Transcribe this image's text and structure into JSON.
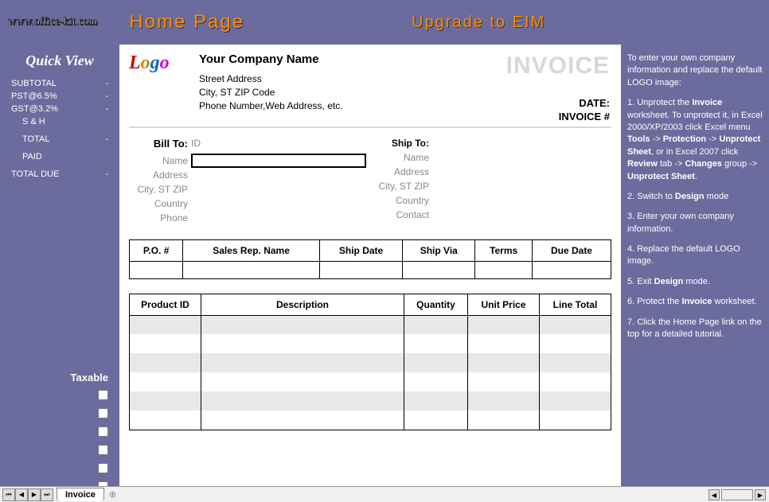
{
  "header": {
    "url": "www.office-kit.com",
    "home_page": "Home Page",
    "upgrade": "Upgrade to EIM"
  },
  "quick_view": {
    "title": "Quick View",
    "rows": [
      {
        "label": "SUBTOTAL",
        "value": "-"
      },
      {
        "label": "PST@6.5%",
        "value": "-"
      },
      {
        "label": "GST@3.2%",
        "value": "-"
      },
      {
        "label": "S & H",
        "value": ""
      },
      {
        "label": "TOTAL",
        "value": "-"
      },
      {
        "label": "PAID",
        "value": ""
      },
      {
        "label": "TOTAL DUE",
        "value": "-"
      }
    ],
    "taxable": "Taxable"
  },
  "company": {
    "name": "Your Company Name",
    "street": "Street Address",
    "city": "City, ST  ZIP Code",
    "phone": "Phone Number,Web Address, etc."
  },
  "invoice": {
    "title": "INVOICE",
    "date_label": "DATE:",
    "number_label": "INVOICE #"
  },
  "bill_to": {
    "title": "Bill To:",
    "labels": [
      "ID",
      "Name",
      "Address",
      "City, ST ZIP",
      "Country",
      "Phone"
    ]
  },
  "ship_to": {
    "title": "Ship To:",
    "labels": [
      "Name",
      "Address",
      "City, ST ZIP",
      "Country",
      "Contact"
    ]
  },
  "info_headers": [
    "P.O. #",
    "Sales Rep. Name",
    "Ship Date",
    "Ship Via",
    "Terms",
    "Due Date"
  ],
  "line_headers": [
    "Product ID",
    "Description",
    "Quantity",
    "Unit Price",
    "Line Total"
  ],
  "instructions": {
    "intro": "To enter your own company information and replace the default LOGO image:",
    "s1a": "1. Unprotect the ",
    "s1b": "Invoice",
    "s1c": " worksheet. To unprotect it, in Excel 2000/XP/2003 click Excel menu ",
    "s1d": "Tools",
    "s1e": " -> ",
    "s1f": "Protection",
    "s1g": " -> ",
    "s1h": "Unprotect Sheet",
    "s1i": ", or in Excel 2007 click ",
    "s1j": "Review",
    "s1k": " tab -> ",
    "s1l": "Changes",
    "s1m": " group -> ",
    "s1n": "Unprotect Sheet",
    "s1o": ".",
    "s2a": "2. Switch to ",
    "s2b": "Design",
    "s2c": " mode",
    "s3": "3. Enter your own company information.",
    "s4": "4. Replace the default LOGO image.",
    "s5a": "5. Exit ",
    "s5b": "Design",
    "s5c": " mode.",
    "s6a": "6. Protect the ",
    "s6b": "Invoice",
    "s6c": " worksheet.",
    "s7": "7. Click the Home Page link on the top for a detailed tutorial."
  },
  "tab": {
    "name": "Invoice"
  }
}
